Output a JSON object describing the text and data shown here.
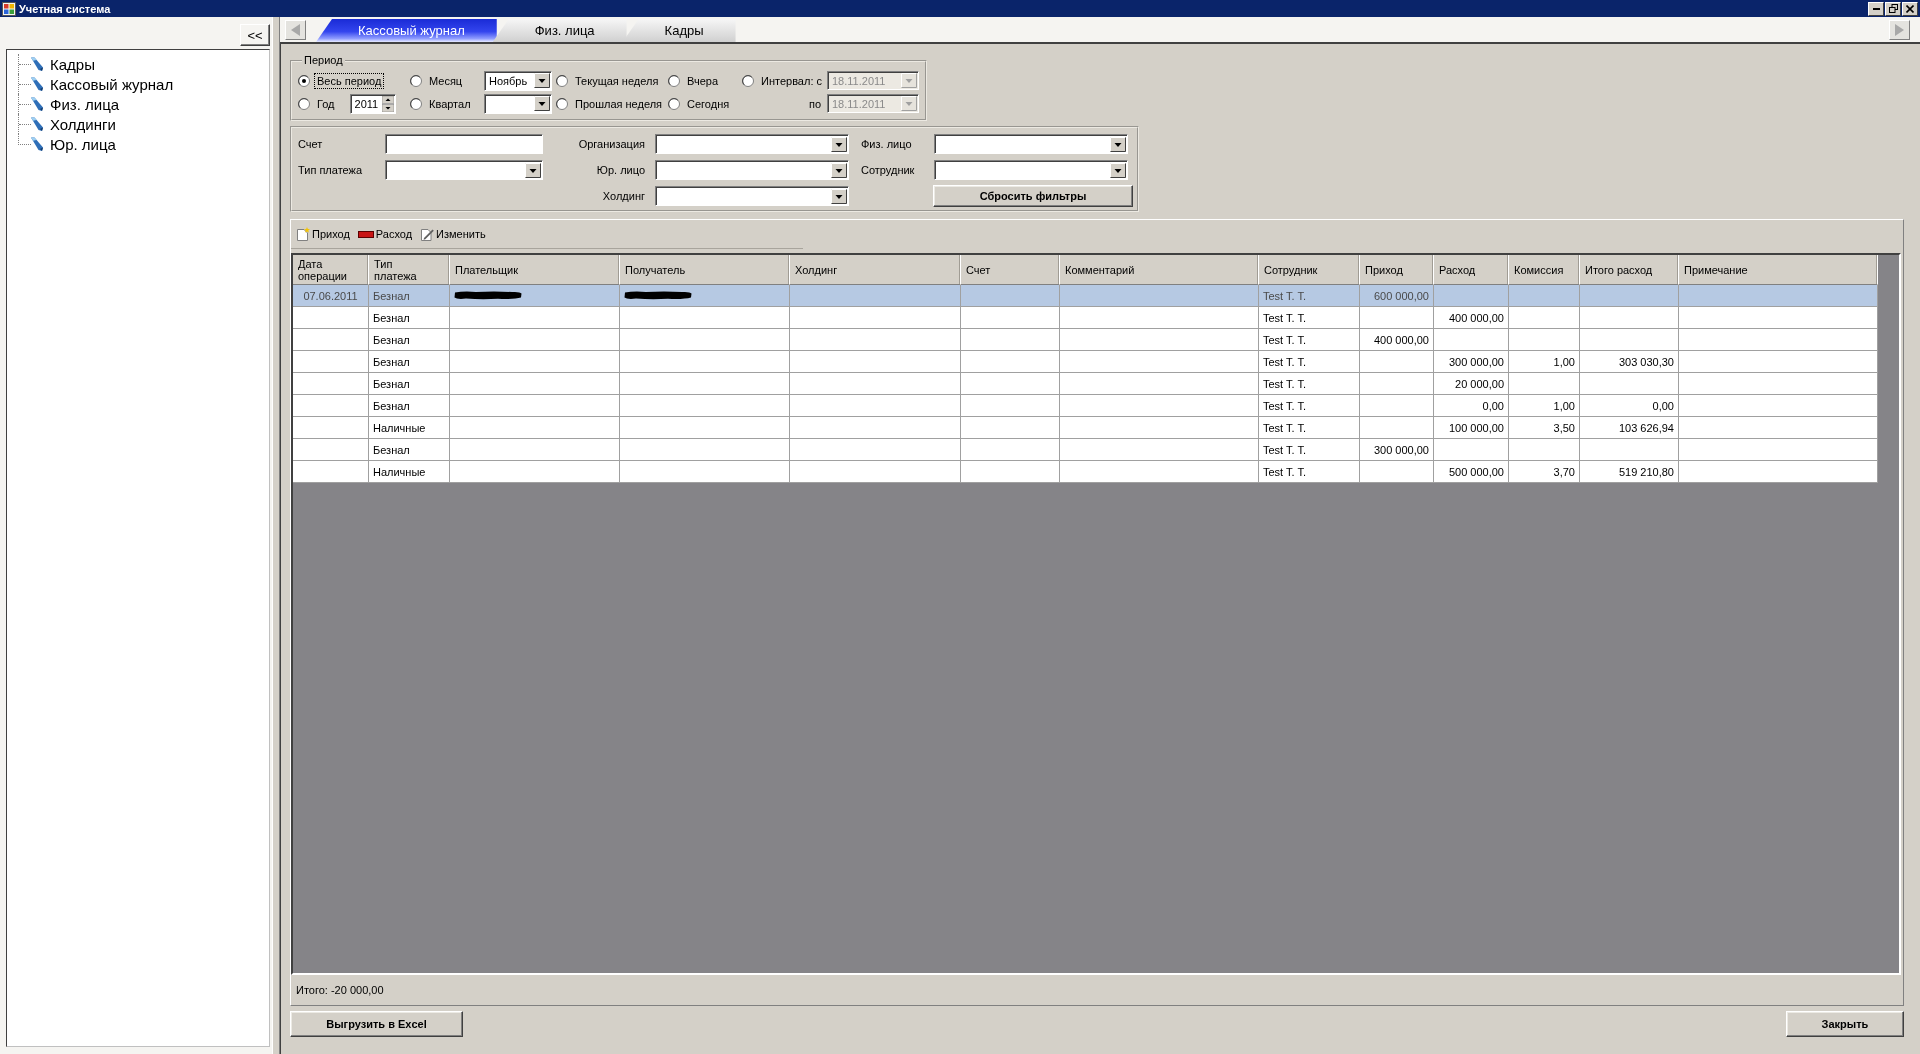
{
  "window": {
    "title": "Учетная система"
  },
  "sidebar": {
    "collapse_button": "<<",
    "tree": [
      {
        "label": "Кадры"
      },
      {
        "label": "Кассовый журнал"
      },
      {
        "label": "Физ. лица"
      },
      {
        "label": "Холдинги"
      },
      {
        "label": "Юр. лица"
      }
    ]
  },
  "tabs": [
    {
      "label": "Кассовый журнал",
      "selected": true
    },
    {
      "label": "Физ. лица",
      "selected": false
    },
    {
      "label": "Кадры",
      "selected": false
    }
  ],
  "period": {
    "title": "Период",
    "options": [
      {
        "label": "Весь период",
        "kind": "plain",
        "selected": true,
        "focused": true
      },
      {
        "label": "Год",
        "kind": "spin",
        "value": "2011",
        "selected": false,
        "focused": false
      },
      {
        "label": "Месяц",
        "kind": "combo",
        "value": "Ноябрь",
        "selected": false,
        "focused": false
      },
      {
        "label": "Квартал",
        "kind": "combo",
        "selected": false,
        "focused": false
      },
      {
        "label": "Текущая неделя",
        "kind": "plain",
        "selected": false,
        "focused": false
      },
      {
        "label": "Прошлая неделя",
        "kind": "plain",
        "selected": false,
        "focused": false
      },
      {
        "label": "Вчера",
        "kind": "plain",
        "selected": false,
        "focused": false
      },
      {
        "label": "Сегодня",
        "kind": "plain",
        "selected": false,
        "focused": false
      },
      {
        "label": "Интервал: с",
        "kind": "date",
        "value": "18.11.2011",
        "disabled": true,
        "selected": false,
        "focused": false
      }
    ],
    "to": {
      "label": "по",
      "value": "18.11.2011",
      "disabled": true
    }
  },
  "filters": {
    "groups": [
      [
        {
          "label": "Счет",
          "kind": "text"
        },
        {
          "label": "Тип платежа",
          "kind": "combo"
        }
      ],
      [
        {
          "label": "Организация",
          "kind": "combo"
        },
        {
          "label": "Юр. лицо",
          "kind": "combo"
        },
        {
          "label": "Холдинг",
          "kind": "combo"
        }
      ],
      [
        {
          "label": "Физ. лицо",
          "kind": "combo"
        },
        {
          "label": "Сотрудник",
          "kind": "combo"
        }
      ]
    ],
    "reset_button": "Сбросить фильтры"
  },
  "toolbar": [
    {
      "label": "Приход",
      "kind": "add"
    },
    {
      "label": "Расход",
      "kind": "expense"
    },
    {
      "label": "Изменить",
      "kind": "edit"
    }
  ],
  "table": {
    "columns": [
      "Дата операции",
      "Тип платежа",
      "Плательщик",
      "Получатель",
      "Холдинг",
      "Счет",
      "Комментарий",
      "Сотрудник",
      "Приход",
      "Расход",
      "Комиссия",
      "Итого расход",
      "Примечание"
    ],
    "rows": [
      {
        "date": "07.06.2011",
        "payment_type": "Безнал",
        "employee": "Test T. T.",
        "income": "600 000,00",
        "selected": true,
        "redacted": true
      },
      {
        "payment_type": "Безнал",
        "employee": "Test T. T.",
        "expense": "400 000,00",
        "selected": false,
        "redacted": false
      },
      {
        "payment_type": "Безнал",
        "employee": "Test T. T.",
        "income": "400 000,00",
        "selected": false,
        "redacted": false
      },
      {
        "payment_type": "Безнал",
        "employee": "Test T. T.",
        "expense": "300 000,00",
        "commission": "1,00",
        "total_expense": "303 030,30",
        "selected": false,
        "redacted": false
      },
      {
        "payment_type": "Безнал",
        "employee": "Test T. T.",
        "expense": "20 000,00",
        "selected": false,
        "redacted": false
      },
      {
        "payment_type": "Безнал",
        "employee": "Test T. T.",
        "expense": "0,00",
        "commission": "1,00",
        "total_expense": "0,00",
        "selected": false,
        "redacted": false
      },
      {
        "payment_type": "Наличные",
        "employee": "Test T. T.",
        "expense": "100 000,00",
        "commission": "3,50",
        "total_expense": "103 626,94",
        "selected": false,
        "redacted": false
      },
      {
        "payment_type": "Безнал",
        "employee": "Test T. T.",
        "income": "300 000,00",
        "selected": false,
        "redacted": false
      },
      {
        "payment_type": "Наличные",
        "employee": "Test T. T.",
        "expense": "500 000,00",
        "commission": "3,70",
        "total_expense": "519 210,80",
        "selected": false,
        "redacted": false
      }
    ]
  },
  "footer": {
    "total": "Итого: -20 000,00"
  },
  "buttons": {
    "export": "Выгрузить в Excel",
    "close": "Закрыть"
  }
}
